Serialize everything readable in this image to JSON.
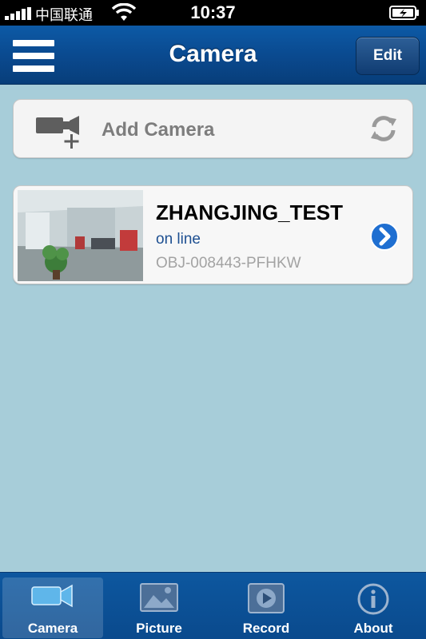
{
  "status_bar": {
    "carrier": "中国联通",
    "time": "10:37"
  },
  "nav": {
    "title": "Camera",
    "edit_label": "Edit"
  },
  "add_camera": {
    "label": "Add Camera",
    "icon": "camera-add-icon",
    "refresh_icon": "refresh-icon"
  },
  "cameras": [
    {
      "name": "ZHANGJING_TEST",
      "status": "on line",
      "id": "OBJ-008443-PFHKW"
    }
  ],
  "tabs": [
    {
      "label": "Camera",
      "icon": "camera-icon",
      "active": true
    },
    {
      "label": "Picture",
      "icon": "picture-icon",
      "active": false
    },
    {
      "label": "Record",
      "icon": "record-icon",
      "active": false
    },
    {
      "label": "About",
      "icon": "info-icon",
      "active": false
    }
  ],
  "colors": {
    "background": "#a7cdd9",
    "nav": "#0a4a90",
    "status_online": "#1d4f91"
  }
}
